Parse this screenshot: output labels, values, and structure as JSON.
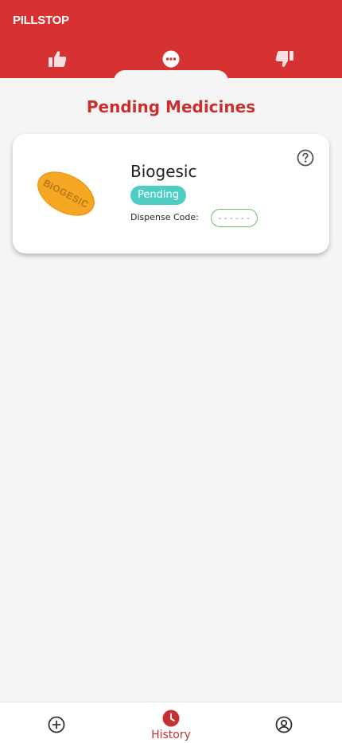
{
  "header": {
    "brand": "PILLSTOP",
    "tabs": [
      {
        "id": "approved",
        "icon": "thumbs-up-icon"
      },
      {
        "id": "pending",
        "icon": "more-dots-icon",
        "active": true
      },
      {
        "id": "rejected",
        "icon": "thumbs-down-icon"
      }
    ],
    "color": "#d63232"
  },
  "section": {
    "title": "Pending Medicines"
  },
  "medicines": [
    {
      "name": "Biogesic",
      "pill_text": "BIOGESIC",
      "status": "Pending",
      "dispense_label": "Dispense Code:",
      "dispense_code": "------",
      "help_icon": "question-circle-icon"
    }
  ],
  "bottom_nav": {
    "items": [
      {
        "id": "add",
        "icon": "plus-circle-icon"
      },
      {
        "id": "history",
        "icon": "clock-icon",
        "label": "History",
        "active": true
      },
      {
        "id": "profile",
        "icon": "user-circle-icon"
      }
    ]
  },
  "colors": {
    "primary": "#d63232",
    "accent_title": "#c83030",
    "status_pending": "#4ecdc4",
    "code_border": "#6cc06c",
    "pill": "#f5a623"
  }
}
